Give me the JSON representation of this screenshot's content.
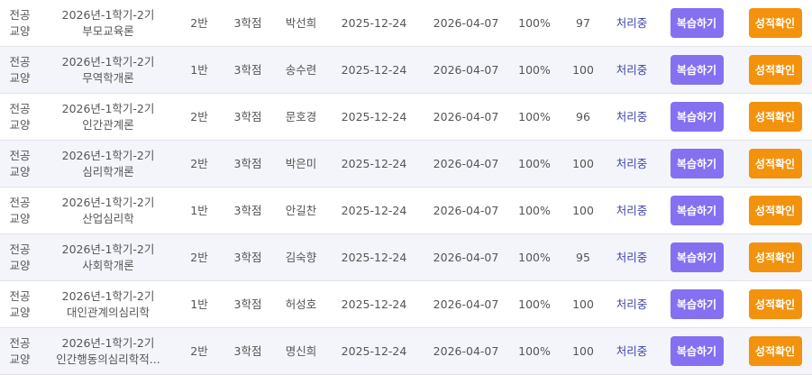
{
  "labels": {
    "review_button": "복습하기",
    "grade_button": "성적확인"
  },
  "colors": {
    "review_button": "#8470f0",
    "grade_button": "#f2920d",
    "status_text": "#3f44a8",
    "alt_row_bg": "#f4f5fb"
  },
  "rows": [
    {
      "category_line1": "전공",
      "category_line2": "교양",
      "term": "2026년-1학기-2기",
      "course": "부모교육론",
      "class": "2반",
      "credits": "3학점",
      "professor": "박선희",
      "start_date": "2025-12-24",
      "end_date": "2026-04-07",
      "progress": "100%",
      "score": "97",
      "status": "처리중"
    },
    {
      "category_line1": "전공",
      "category_line2": "교양",
      "term": "2026년-1학기-2기",
      "course": "무역학개론",
      "class": "1반",
      "credits": "3학점",
      "professor": "송수련",
      "start_date": "2025-12-24",
      "end_date": "2026-04-07",
      "progress": "100%",
      "score": "100",
      "status": "처리중"
    },
    {
      "category_line1": "전공",
      "category_line2": "교양",
      "term": "2026년-1학기-2기",
      "course": "인간관계론",
      "class": "2반",
      "credits": "3학점",
      "professor": "문호경",
      "start_date": "2025-12-24",
      "end_date": "2026-04-07",
      "progress": "100%",
      "score": "96",
      "status": "처리중"
    },
    {
      "category_line1": "전공",
      "category_line2": "교양",
      "term": "2026년-1학기-2기",
      "course": "심리학개론",
      "class": "2반",
      "credits": "3학점",
      "professor": "박은미",
      "start_date": "2025-12-24",
      "end_date": "2026-04-07",
      "progress": "100%",
      "score": "100",
      "status": "처리중"
    },
    {
      "category_line1": "전공",
      "category_line2": "교양",
      "term": "2026년-1학기-2기",
      "course": "산업심리학",
      "class": "1반",
      "credits": "3학점",
      "professor": "안길찬",
      "start_date": "2025-12-24",
      "end_date": "2026-04-07",
      "progress": "100%",
      "score": "100",
      "status": "처리중"
    },
    {
      "category_line1": "전공",
      "category_line2": "교양",
      "term": "2026년-1학기-2기",
      "course": "사회학개론",
      "class": "2반",
      "credits": "3학점",
      "professor": "김숙향",
      "start_date": "2025-12-24",
      "end_date": "2026-04-07",
      "progress": "100%",
      "score": "95",
      "status": "처리중"
    },
    {
      "category_line1": "전공",
      "category_line2": "교양",
      "term": "2026년-1학기-2기",
      "course": "대인관계의심리학",
      "class": "1반",
      "credits": "3학점",
      "professor": "허성호",
      "start_date": "2025-12-24",
      "end_date": "2026-04-07",
      "progress": "100%",
      "score": "100",
      "status": "처리중"
    },
    {
      "category_line1": "전공",
      "category_line2": "교양",
      "term": "2026년-1학기-2기",
      "course": "인간행동의심리학적...",
      "class": "2반",
      "credits": "3학점",
      "professor": "명신희",
      "start_date": "2025-12-24",
      "end_date": "2026-04-07",
      "progress": "100%",
      "score": "100",
      "status": "처리중"
    }
  ]
}
